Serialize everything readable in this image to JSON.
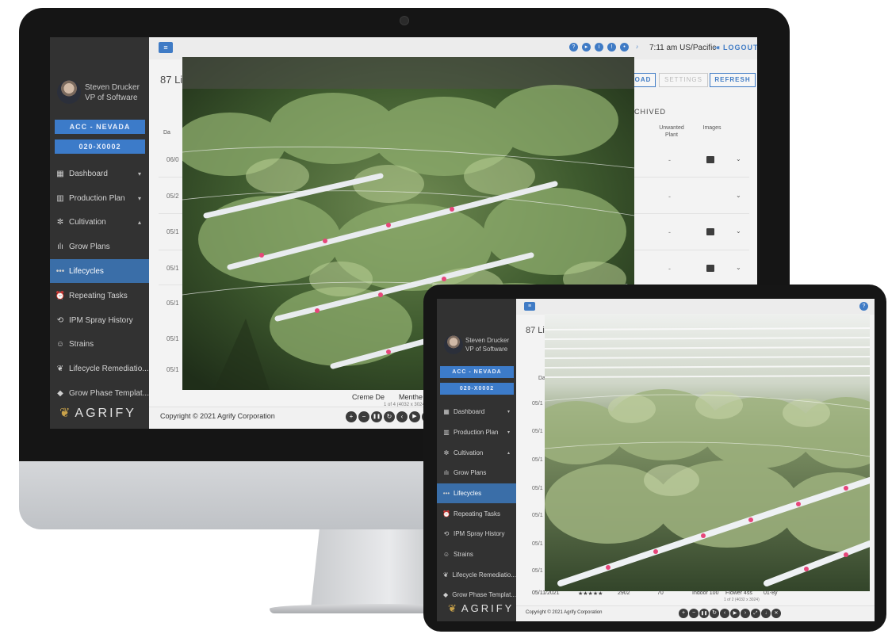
{
  "user": {
    "name": "Steven Drucker",
    "role": "VP of Software"
  },
  "facility": "ACC - NEVADA",
  "room": "020-X0002",
  "nav": [
    {
      "label": "Dashboard",
      "icon": "dashboard-icon",
      "glyph": "▦",
      "chevron": "▾"
    },
    {
      "label": "Production Plan",
      "icon": "map-icon",
      "glyph": "▥",
      "chevron": "▾"
    },
    {
      "label": "Cultivation",
      "icon": "cultivation-icon",
      "glyph": "✼",
      "chevron": "▴"
    },
    {
      "label": "Grow Plans",
      "icon": "bar-chart-icon",
      "glyph": "ılı"
    },
    {
      "label": "Lifecycles",
      "icon": "lifecycle-icon",
      "glyph": "•••"
    },
    {
      "label": "Repeating Tasks",
      "icon": "alarm-icon",
      "glyph": "⏰"
    },
    {
      "label": "IPM Spray History",
      "icon": "history-icon",
      "glyph": "⟲"
    },
    {
      "label": "Strains",
      "icon": "smiley-icon",
      "glyph": "☺"
    },
    {
      "label": "Lifecycle Remediatio...",
      "icon": "plant-icon",
      "glyph": "❦"
    },
    {
      "label": "Grow Phase Templat...",
      "icon": "diamond-icon",
      "glyph": "◆"
    }
  ],
  "brand": "AGRIFY",
  "desktop": {
    "time": "7:11 am US/Pacific",
    "logout": "LOGOUT",
    "page_title_partial": "87 Li",
    "buttons": {
      "download_partial": "OAD",
      "settings": "SETTINGS",
      "refresh": "REFRESH"
    },
    "tab_archived": "CHIVED",
    "columns": {
      "unwanted": "Unwanted Plant",
      "images": "Images",
      "date_partial": "Da"
    },
    "dates": [
      "06/0",
      "05/2",
      "05/1",
      "05/1",
      "05/1",
      "05/1",
      "05/1"
    ],
    "dash": "-",
    "caption_strain": "Creme De",
    "caption_strain2": "Menthe",
    "caption_counter": "1 of 4 (4032 x 3024)"
  },
  "tablet": {
    "page_title_partial": "87 Li",
    "col_partial": "Da",
    "dates": [
      "05/1",
      "05/1",
      "05/1",
      "05/1",
      "05/1",
      "05/1",
      "05/1",
      "05/1",
      "05/11/2021"
    ],
    "caption_row": [
      "★★★★★",
      "2902",
      "70",
      "Indoor 100",
      "Flower 4ss",
      "01-8y"
    ],
    "caption_counter": "1 of 2 (4032 x 3024)"
  },
  "footer": "Copyright © 2021 Agrify Corporation",
  "controls": [
    "+",
    "−",
    "❚❚",
    "↻",
    "‹",
    "▶",
    "›"
  ],
  "controls_tablet": [
    "+",
    "−",
    "❚❚",
    "↻",
    "‹",
    "▶",
    "›",
    "⤢",
    "↓",
    "✕"
  ]
}
